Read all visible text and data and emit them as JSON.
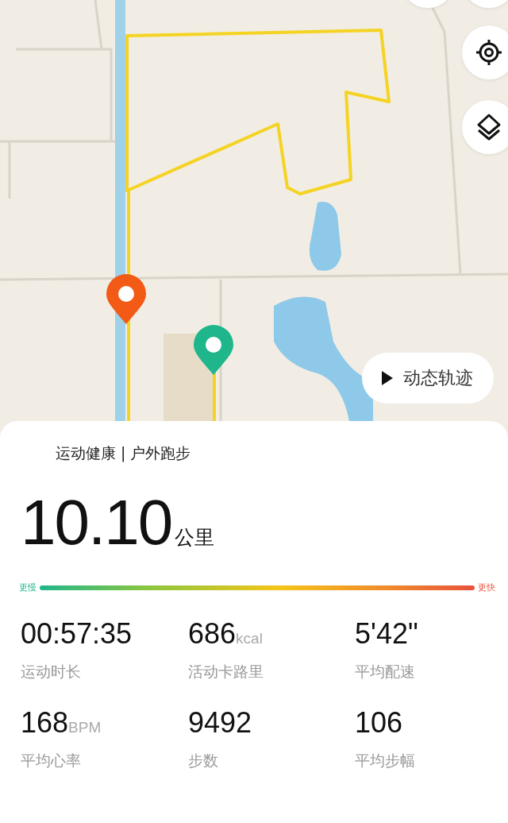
{
  "map": {
    "replay_button": "动态轨迹"
  },
  "summary": {
    "title": "运动健康 | 户外跑步",
    "distance": "10.10",
    "distance_unit": "公里"
  },
  "pace_scale": {
    "slow_label": "更慢",
    "fast_label": "更快"
  },
  "stats": [
    {
      "value": "00:57:35",
      "label": "运动时长"
    },
    {
      "value": "686",
      "unit": "kcal",
      "label": "活动卡路里"
    },
    {
      "value": "5'42\"",
      "label": "平均配速"
    },
    {
      "value": "168",
      "unit": "BPM",
      "label": "平均心率"
    },
    {
      "value": "9492",
      "label": "步数"
    },
    {
      "value": "106",
      "label": "平均步幅"
    }
  ]
}
